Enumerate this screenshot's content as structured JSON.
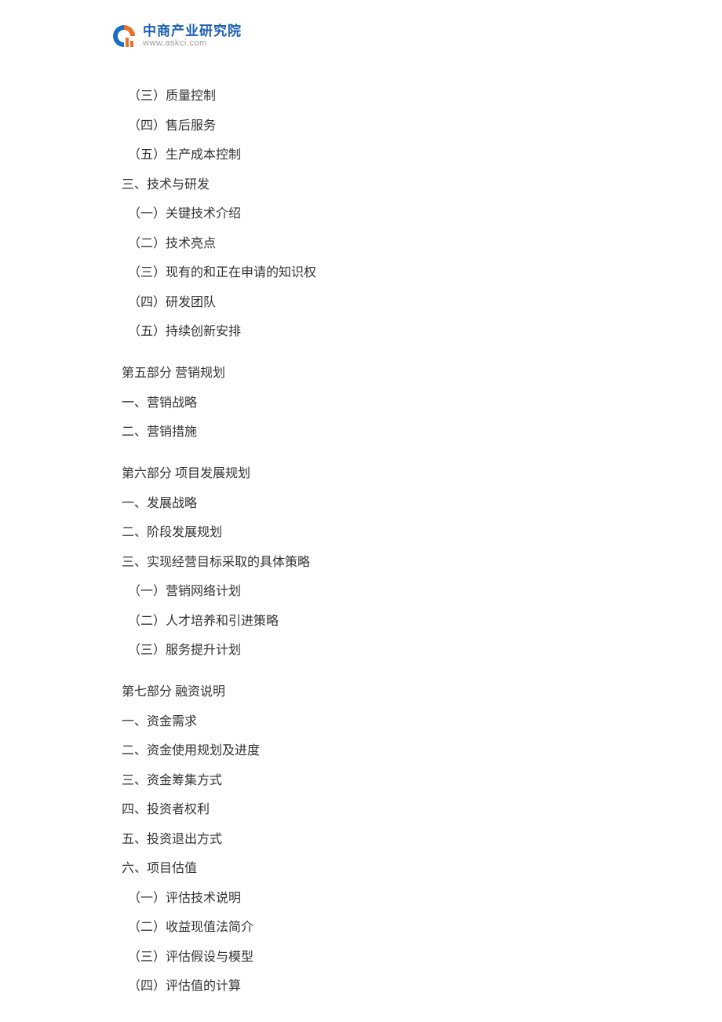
{
  "logo": {
    "chinese": "中商产业研究院",
    "url": "www.askci.com"
  },
  "toc": {
    "group1": [
      "（三）质量控制",
      "（四）售后服务",
      "（五）生产成本控制",
      "三、技术与研发",
      "（一）关键技术介绍",
      "（二）技术亮点",
      "（三）现有的和正在申请的知识权",
      "（四）研发团队",
      "（五）持续创新安排"
    ],
    "section5_title": "第五部分  营销规划",
    "section5_items": [
      "一、营销战略",
      "二、营销措施"
    ],
    "section6_title": "第六部分  项目发展规划",
    "section6_items": [
      "一、发展战略",
      "二、阶段发展规划",
      "三、实现经营目标采取的具体策略",
      "（一）营销网络计划",
      "（二）人才培养和引进策略",
      "（三）服务提升计划"
    ],
    "section7_title": "第七部分  融资说明",
    "section7_items": [
      "一、资金需求",
      "二、资金使用规划及进度",
      "三、资金筹集方式",
      "四、投资者权利",
      "五、投资退出方式",
      "六、项目估值",
      "（一）评估技术说明",
      "（二）收益现值法简介",
      "（三）评估假设与模型",
      "（四）评估值的计算"
    ]
  }
}
